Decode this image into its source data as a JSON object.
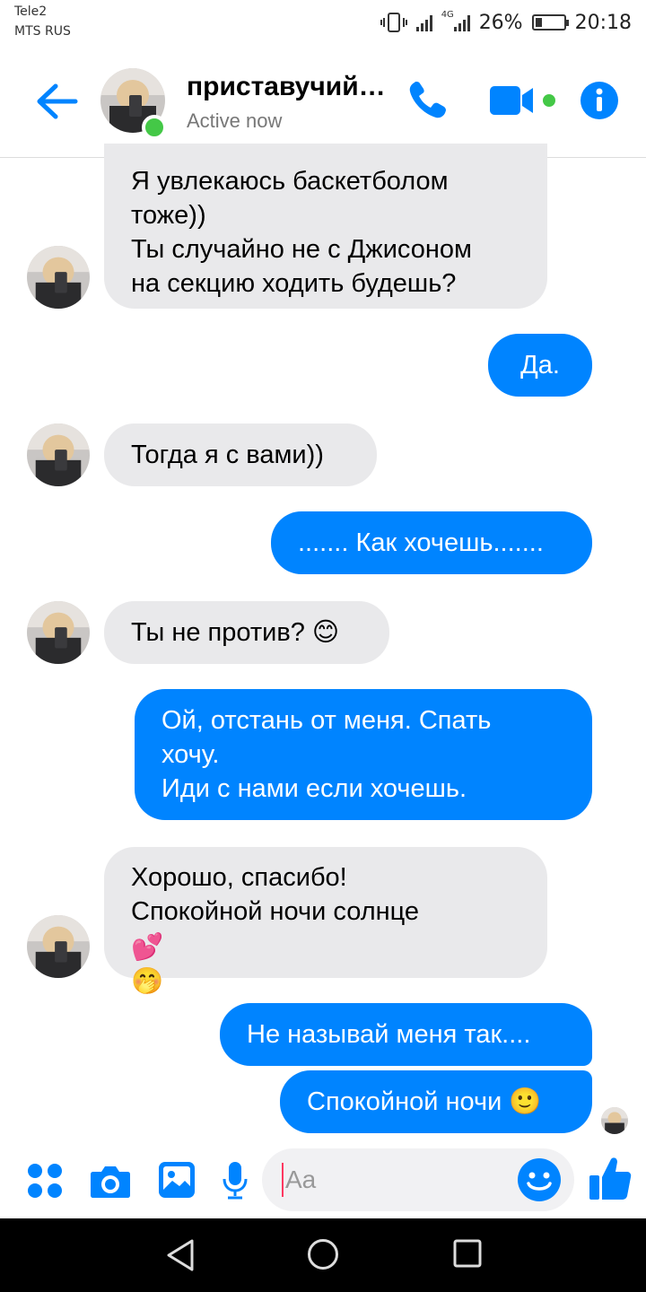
{
  "status_bar": {
    "carrier1": "Tele2",
    "carrier2": "MTS RUS",
    "network": "4G",
    "battery_text": "26%",
    "battery_level": 0.26,
    "time": "20:18"
  },
  "header": {
    "name": "приставучий…",
    "status": "Active now"
  },
  "colors": {
    "accent": "#0084ff",
    "incoming_bubble": "#e9e9eb",
    "online": "#44c847"
  },
  "messages": [
    {
      "dir": "in",
      "text": "Я увлекаюсь баскетболом\nтоже))\nТы случайно не с Джисоном\nна секцию ходить будешь?"
    },
    {
      "dir": "out",
      "text": "Да."
    },
    {
      "dir": "in",
      "text": "Тогда я с вами))"
    },
    {
      "dir": "out",
      "text": "....... Как хочешь......."
    },
    {
      "dir": "in",
      "text": "Ты не против?",
      "emoji": "😊"
    },
    {
      "dir": "out",
      "text": "Ой, отстань от меня. Спать\nхочу.\nИди с нами если хочешь."
    },
    {
      "dir": "in",
      "text": "Хорошо, спасибо!\nСпокойной ночи солнце",
      "emoji": "💕",
      "emoji2": "🤭"
    },
    {
      "dir": "out",
      "text": "Не называй меня так...."
    },
    {
      "dir": "out",
      "text": "Спокойной ночи",
      "emoji": "🙂"
    }
  ],
  "composer": {
    "placeholder": "Aa"
  },
  "icons": {
    "back": "arrow-left-icon",
    "phone": "phone-icon",
    "video": "video-camera-icon",
    "info": "info-icon",
    "menu": "four-dots-icon",
    "camera": "camera-icon",
    "gallery": "image-icon",
    "mic": "microphone-icon",
    "emoji": "smiley-icon",
    "like": "thumbs-up-icon"
  }
}
